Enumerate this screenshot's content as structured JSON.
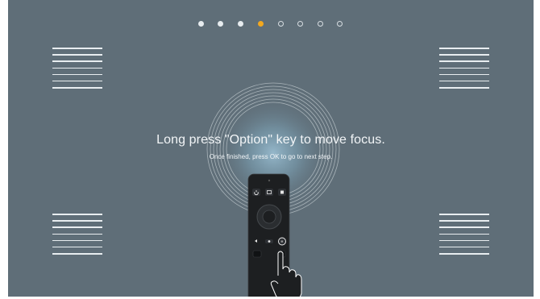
{
  "instructions": {
    "headline": "Long press \"Option\" key to move focus.",
    "subline": "Once finished, press OK to go to next step."
  },
  "progress": {
    "total_steps": 8,
    "current_step": 4
  },
  "colors": {
    "background": "#5f6e78",
    "accent": "#f2a81f",
    "text": "#f2f5f7",
    "remote_body": "#1d1f21"
  },
  "icons": [
    "power-icon",
    "input-icon",
    "settings-icon",
    "ok-ring-icon",
    "back-icon",
    "option-icon",
    "home-icon",
    "hand-pointer-icon",
    "decorative-lines"
  ]
}
